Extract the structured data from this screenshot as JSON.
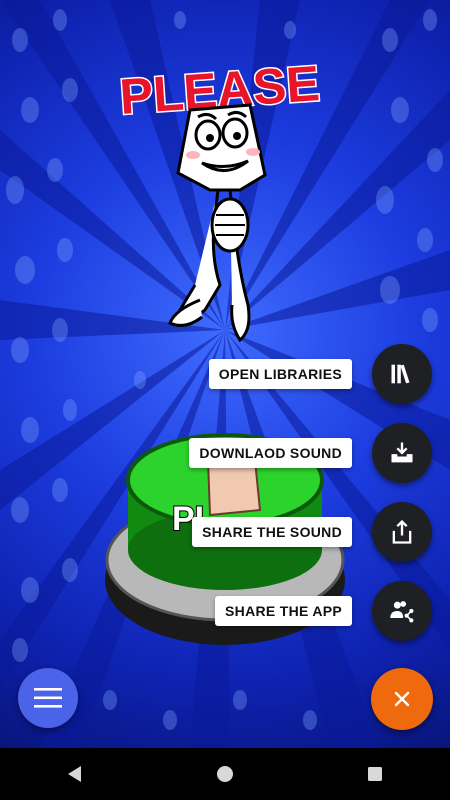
{
  "menu": {
    "open_libraries": "OPEN LIBRARIES",
    "download_sound": "DOWNLAOD SOUND",
    "share_sound": "SHARE THE SOUND",
    "share_app": "SHARE THE APP"
  },
  "artwork": {
    "title_text": "PLEASE",
    "button_text": "PL"
  },
  "colors": {
    "fab_close": "#ee6a0d",
    "fab_menu": "#4a63e8",
    "mini_fab": "#1e2023",
    "button_green": "#2dd32d",
    "background_blue": "#1d3de0"
  },
  "icons": {
    "open_libraries": "library-icon",
    "download_sound": "download-tray-icon",
    "share_sound": "share-icon",
    "share_app": "share-people-icon",
    "close": "close-icon",
    "menu": "hamburger-icon",
    "nav_back": "back-icon",
    "nav_home": "home-icon",
    "nav_recents": "recents-icon"
  }
}
